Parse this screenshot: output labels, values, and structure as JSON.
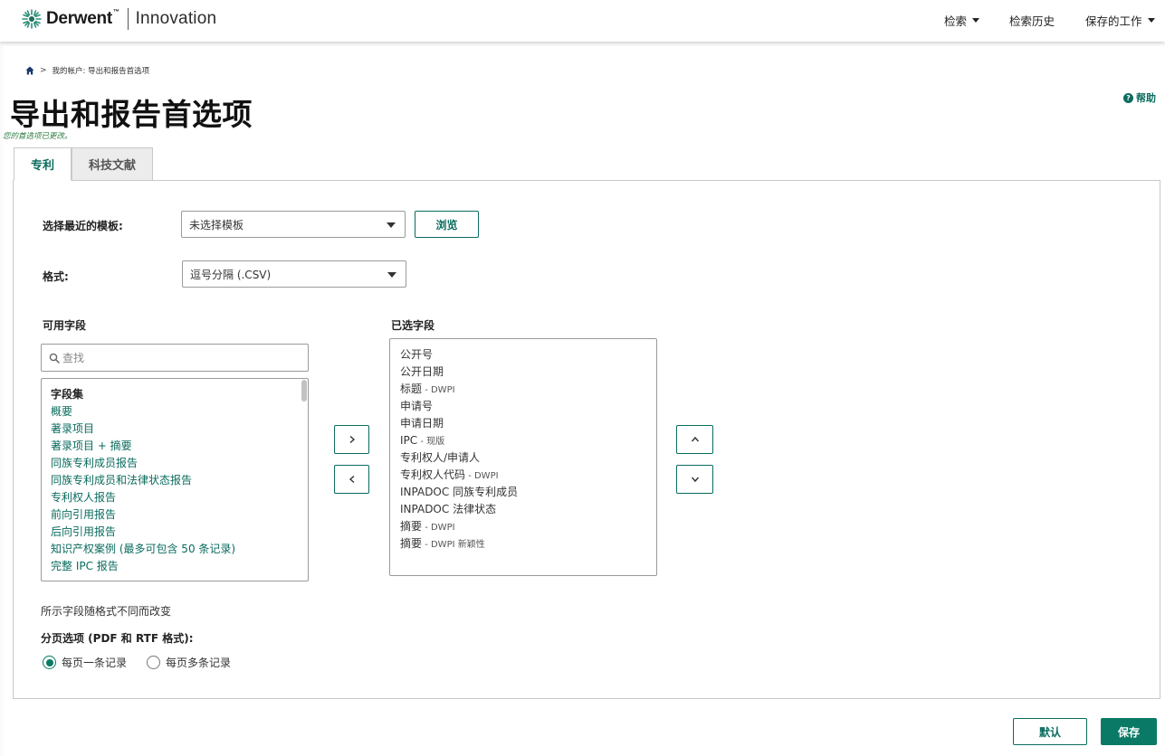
{
  "header": {
    "brand": "Derwent",
    "brand_tm": "™",
    "product": "Innovation",
    "nav": {
      "search": "检索",
      "history": "检索历史",
      "saved_work": "保存的工作"
    }
  },
  "breadcrumb": {
    "path": "我的帐户: 导出和报告首选项"
  },
  "page": {
    "title": "导出和报告首选项",
    "saved_message": "您的首选项已更改。",
    "help": "帮助"
  },
  "tabs": [
    {
      "label": "专利",
      "active": true
    },
    {
      "label": "科技文献",
      "active": false
    }
  ],
  "form": {
    "template_label": "选择最近的模板:",
    "template_value": "未选择模板",
    "browse_label": "浏览",
    "format_label": "格式:",
    "format_value": "逗号分隔 (.CSV)",
    "available_label": "可用字段",
    "selected_label": "已选字段",
    "search_placeholder": "查找",
    "available_group": "字段集",
    "available_fields": [
      "概要",
      "著录项目",
      "著录项目 + 摘要",
      "同族专利成员报告",
      "同族专利成员和法律状态报告",
      "专利权人报告",
      "前向引用报告",
      "后向引用报告",
      "知识产权案例 (最多可包含 50 条记录)",
      "完整 IPC 报告"
    ],
    "selected_fields": [
      {
        "name": "公开号",
        "suffix": ""
      },
      {
        "name": "公开日期",
        "suffix": ""
      },
      {
        "name": "标题",
        "suffix": " - DWPI"
      },
      {
        "name": "申请号",
        "suffix": ""
      },
      {
        "name": "申请日期",
        "suffix": ""
      },
      {
        "name": "IPC",
        "suffix": " - 现版"
      },
      {
        "name": "专利权人/申请人",
        "suffix": ""
      },
      {
        "name": "专利权人代码",
        "suffix": " - DWPI"
      },
      {
        "name": "INPADOC 同族专利成员",
        "suffix": ""
      },
      {
        "name": "INPADOC 法律状态",
        "suffix": ""
      },
      {
        "name": "摘要",
        "suffix": " - DWPI"
      },
      {
        "name": "摘要",
        "suffix": " - DWPI 新颖性"
      }
    ],
    "fields_note": "所示字段随格式不同而改变",
    "pagination_label": "分页选项 (PDF 和 RTF 格式):",
    "pagination_options": [
      {
        "label": "每页一条记录",
        "checked": true
      },
      {
        "label": "每页多条记录",
        "checked": false
      }
    ]
  },
  "footer": {
    "default_label": "默认",
    "save_label": "保存"
  },
  "colors": {
    "accent": "#0a6b5e",
    "save_bg": "#0a7a66",
    "saved_msg": "#2c7a3f"
  }
}
